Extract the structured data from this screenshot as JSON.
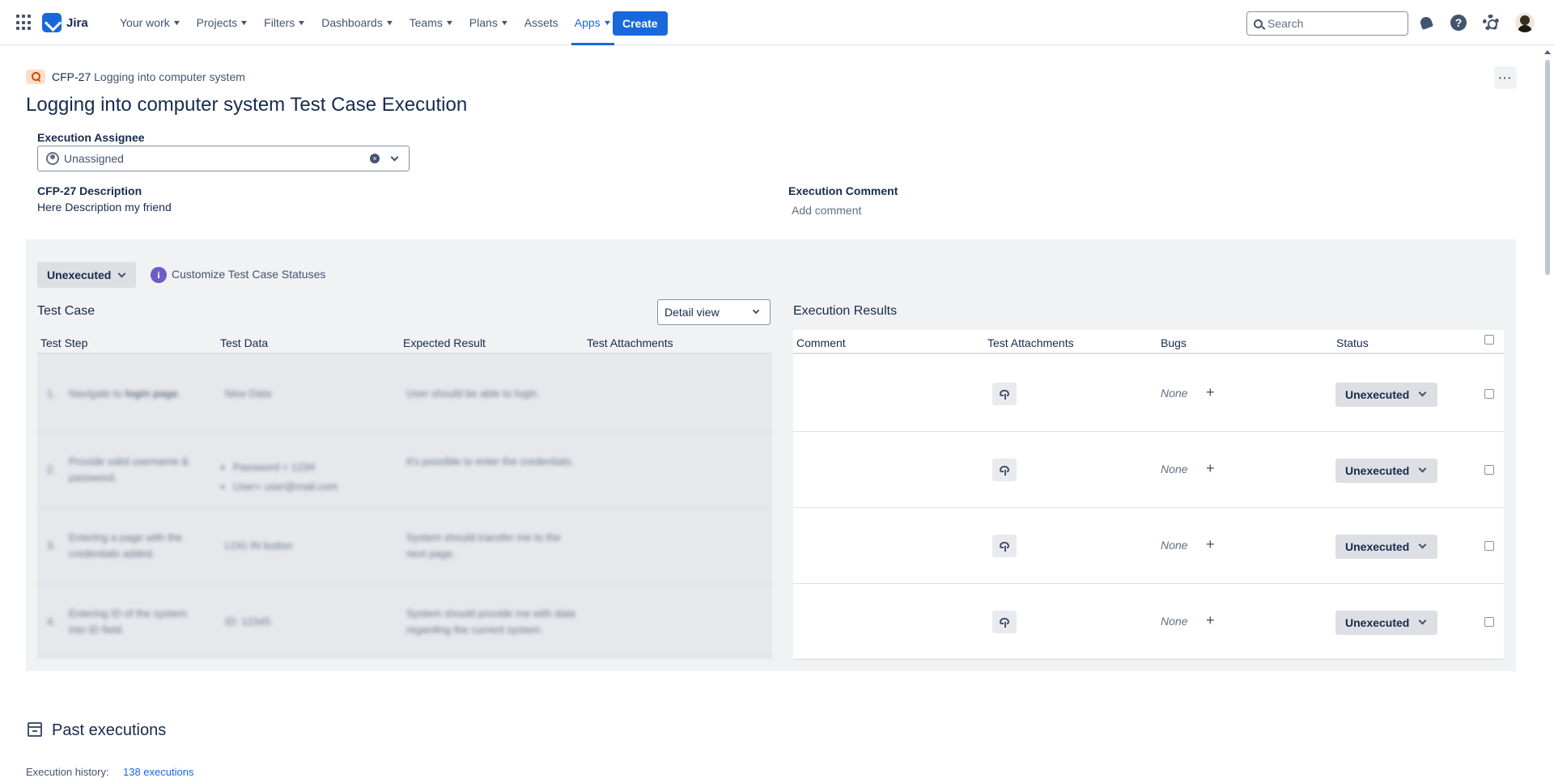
{
  "nav": {
    "product": "Jira",
    "items": [
      {
        "label": "Your work",
        "dropdown": true
      },
      {
        "label": "Projects",
        "dropdown": true
      },
      {
        "label": "Filters",
        "dropdown": true
      },
      {
        "label": "Dashboards",
        "dropdown": true
      },
      {
        "label": "Teams",
        "dropdown": true
      },
      {
        "label": "Plans",
        "dropdown": true
      },
      {
        "label": "Assets",
        "dropdown": false
      },
      {
        "label": "Apps",
        "dropdown": true,
        "active": true
      }
    ],
    "create_label": "Create",
    "search_placeholder": "Search",
    "icons": [
      "app-switcher-icon",
      "notifications-icon",
      "help-icon",
      "settings-icon",
      "avatar"
    ]
  },
  "issue": {
    "key": "CFP-27",
    "summary": "Logging into computer system",
    "title": "Logging into computer system Test Case Execution",
    "more_label": "···"
  },
  "assignee": {
    "label": "Execution Assignee",
    "value": "Unassigned"
  },
  "description": {
    "label": "CFP-27 Description",
    "text": "Here Description my friend"
  },
  "comment": {
    "label": "Execution Comment",
    "placeholder": "Add comment"
  },
  "execution": {
    "status": "Unexecuted",
    "customize_label": "Customize Test Case Statuses",
    "test_case_title": "Test Case",
    "view_select": "Detail view",
    "results_title": "Execution Results",
    "tc_columns": [
      "Test Step",
      "Test Data",
      "Expected Result",
      "Test Attachments"
    ],
    "er_columns": [
      "Comment",
      "Test Attachments",
      "Bugs",
      "Status"
    ],
    "steps": [
      {
        "num": "1.",
        "step": "Navigate to login page.",
        "data": "New Data",
        "data_list": [],
        "expected": "User should be able to login."
      },
      {
        "num": "2.",
        "step": "Provide valid username & password.",
        "data": "",
        "data_list": [
          "Password = 1234",
          "User= user@mail.com"
        ],
        "expected": "It's possible to enter the credentials."
      },
      {
        "num": "3.",
        "step": "Entering a page with the credentials added.",
        "data": "LOG IN button",
        "data_list": [],
        "expected": "System should transfer me to the next page."
      },
      {
        "num": "4.",
        "step": "Entering ID of the system into ID field.",
        "data": "ID: 12345",
        "data_list": [],
        "expected": "System should provide me with data regarding the current system."
      }
    ],
    "results": [
      {
        "bugs": "None",
        "status": "Unexecuted"
      },
      {
        "bugs": "None",
        "status": "Unexecuted"
      },
      {
        "bugs": "None",
        "status": "Unexecuted"
      },
      {
        "bugs": "None",
        "status": "Unexecuted"
      }
    ]
  },
  "past": {
    "title": "Past executions",
    "history_label": "Execution history:",
    "history_link": "138 executions"
  },
  "colors": {
    "accent": "#1868db",
    "panel_bg": "#f1f2f4",
    "status_bg": "#dcdfe4"
  }
}
